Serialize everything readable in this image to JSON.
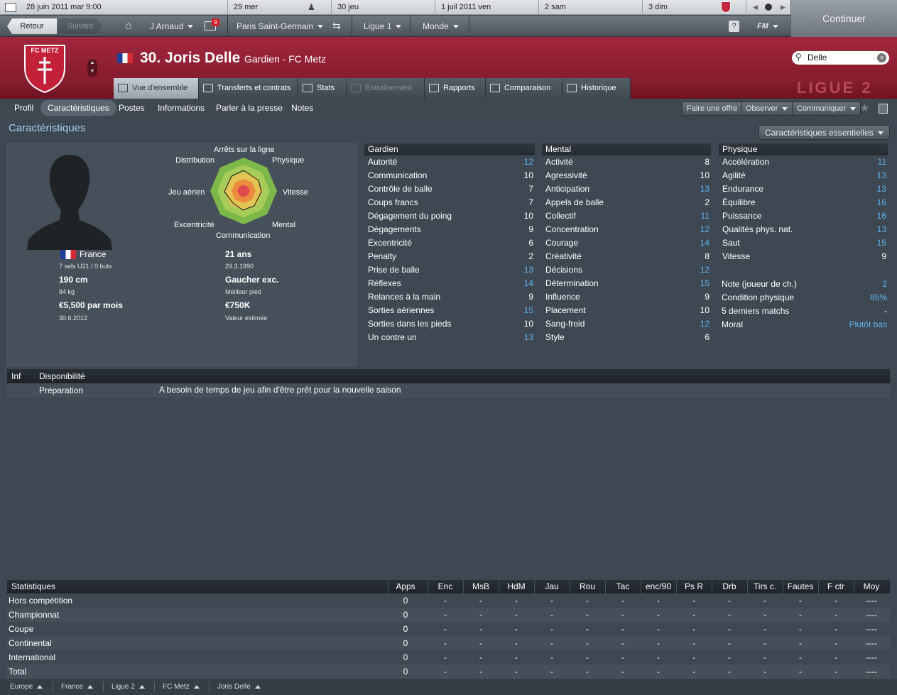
{
  "calendar": {
    "days": [
      "28 juin 2011 mar 9:00",
      "29 mer",
      "30 jeu",
      "1 juil 2011 ven",
      "2 sam",
      "3 dim"
    ]
  },
  "nav": {
    "back": "Retour",
    "forward": "Suivant",
    "manager": "J Arnaud",
    "inbox_count": "9",
    "club": "Paris Saint-Germain",
    "league": "Ligue 1",
    "world": "Monde",
    "help": "?",
    "fm": "FM",
    "continue": "Continuer"
  },
  "player": {
    "title": "30. Joris Delle",
    "subtitle": "Gardien - FC Metz",
    "club_logo": "FC METZ",
    "league_badge": "LIGUE 2",
    "search": "Delle"
  },
  "tabs": [
    "Vue d'ensemble",
    "Transferts et contrats",
    "Stats",
    "Entraînement",
    "Rapports",
    "Comparaison",
    "Historique"
  ],
  "subnav": {
    "items": [
      "Profil",
      "Caractéristiques",
      "Postes",
      "Informations",
      "Parler à la presse",
      "Notes"
    ],
    "buttons": [
      "Faire une offre",
      "Observer",
      "Communiquer"
    ]
  },
  "page_title": "Caractéristiques",
  "view_select": "Caractéristiques essentielles",
  "radar": {
    "labels": [
      "Arrêts sur la ligne",
      "Physique",
      "Vitesse",
      "Mental",
      "Communication",
      "Excentricité",
      "Jeu aérien",
      "Distribution"
    ]
  },
  "profile": {
    "nation": "France",
    "caps": "7 sels U21 / 0 buts",
    "height": "190 cm",
    "weight": "84 kg",
    "wage": "€5,500 par mois",
    "contract": "30.6.2012",
    "age": "21 ans",
    "dob": "29.3.1990",
    "foot": "Gaucher exc.",
    "foot_label": "Meilleur pied",
    "value": "€750K",
    "value_label": "Valeur estimée"
  },
  "attributes": {
    "gardien": {
      "title": "Gardien",
      "rows": [
        [
          "Autorité",
          "12"
        ],
        [
          "Communication",
          "10"
        ],
        [
          "Contrôle de balle",
          "7"
        ],
        [
          "Coups francs",
          "7"
        ],
        [
          "Dégagement du poing",
          "10"
        ],
        [
          "Dégagements",
          "9"
        ],
        [
          "Excentricité",
          "6"
        ],
        [
          "Penalty",
          "2"
        ],
        [
          "Prise de balle",
          "13"
        ],
        [
          "Réflexes",
          "14"
        ],
        [
          "Relances à la main",
          "9"
        ],
        [
          "Sorties aériennes",
          "15"
        ],
        [
          "Sorties dans les pieds",
          "10"
        ],
        [
          "Un contre un",
          "13"
        ]
      ]
    },
    "mental": {
      "title": "Mental",
      "rows": [
        [
          "Activité",
          "8"
        ],
        [
          "Agressivité",
          "10"
        ],
        [
          "Anticipation",
          "13"
        ],
        [
          "Appels de balle",
          "2"
        ],
        [
          "Collectif",
          "11"
        ],
        [
          "Concentration",
          "12"
        ],
        [
          "Courage",
          "14"
        ],
        [
          "Créativité",
          "8"
        ],
        [
          "Décisions",
          "12"
        ],
        [
          "Détermination",
          "15"
        ],
        [
          "Influence",
          "9"
        ],
        [
          "Placement",
          "10"
        ],
        [
          "Sang-froid",
          "12"
        ],
        [
          "Style",
          "6"
        ]
      ]
    },
    "physique": {
      "title": "Physique",
      "rows": [
        [
          "Accélération",
          "11"
        ],
        [
          "Agilité",
          "13"
        ],
        [
          "Endurance",
          "13"
        ],
        [
          "Équilibre",
          "16"
        ],
        [
          "Puissance",
          "16"
        ],
        [
          "Qualités phys. nat.",
          "13"
        ],
        [
          "Saut",
          "15"
        ],
        [
          "Vitesse",
          "9"
        ]
      ]
    },
    "extra": [
      [
        "Note (joueur de ch.)",
        "2"
      ],
      [
        "Condition physique",
        "85%"
      ],
      [
        "5 derniers matchs",
        "-"
      ],
      [
        "Moral",
        "Plutôt bas"
      ]
    ]
  },
  "info": {
    "col1": "Inf",
    "col2": "Disponibilité",
    "row_label": "Préparation",
    "row_text": "A besoin de temps de jeu afin d'être prêt pour la nouvelle saison"
  },
  "stats": {
    "title": "Statistiques",
    "headers": [
      "Apps",
      "Enc",
      "MsB",
      "HdM",
      "Jau",
      "Rou",
      "Tac",
      "enc/90",
      "Ps R",
      "Drb",
      "Tirs c.",
      "Fautes",
      "F ctr",
      "Moy"
    ],
    "rows": [
      {
        "label": "Hors compétition",
        "cells": [
          "0",
          "-",
          "-",
          "-",
          "-",
          "-",
          "-",
          "-",
          "-",
          "-",
          "-",
          "-",
          "-",
          "----"
        ]
      },
      {
        "label": "Championnat",
        "cells": [
          "0",
          "-",
          "-",
          "-",
          "-",
          "-",
          "-",
          "-",
          "-",
          "-",
          "-",
          "-",
          "-",
          "----"
        ]
      },
      {
        "label": "Coupe",
        "cells": [
          "0",
          "-",
          "-",
          "-",
          "-",
          "-",
          "-",
          "-",
          "-",
          "-",
          "-",
          "-",
          "-",
          "----"
        ]
      },
      {
        "label": "Continental",
        "cells": [
          "0",
          "-",
          "-",
          "-",
          "-",
          "-",
          "-",
          "-",
          "-",
          "-",
          "-",
          "-",
          "-",
          "----"
        ]
      },
      {
        "label": "International",
        "cells": [
          "0",
          "-",
          "-",
          "-",
          "-",
          "-",
          "-",
          "-",
          "-",
          "-",
          "-",
          "-",
          "-",
          "----"
        ]
      },
      {
        "label": "Total",
        "cells": [
          "0",
          "-",
          "-",
          "-",
          "-",
          "-",
          "-",
          "-",
          "-",
          "-",
          "-",
          "-",
          "-",
          "----"
        ]
      }
    ]
  },
  "breadcrumbs": [
    "Europe",
    "France",
    "Ligue 2",
    "FC Metz",
    "Joris Delle"
  ]
}
